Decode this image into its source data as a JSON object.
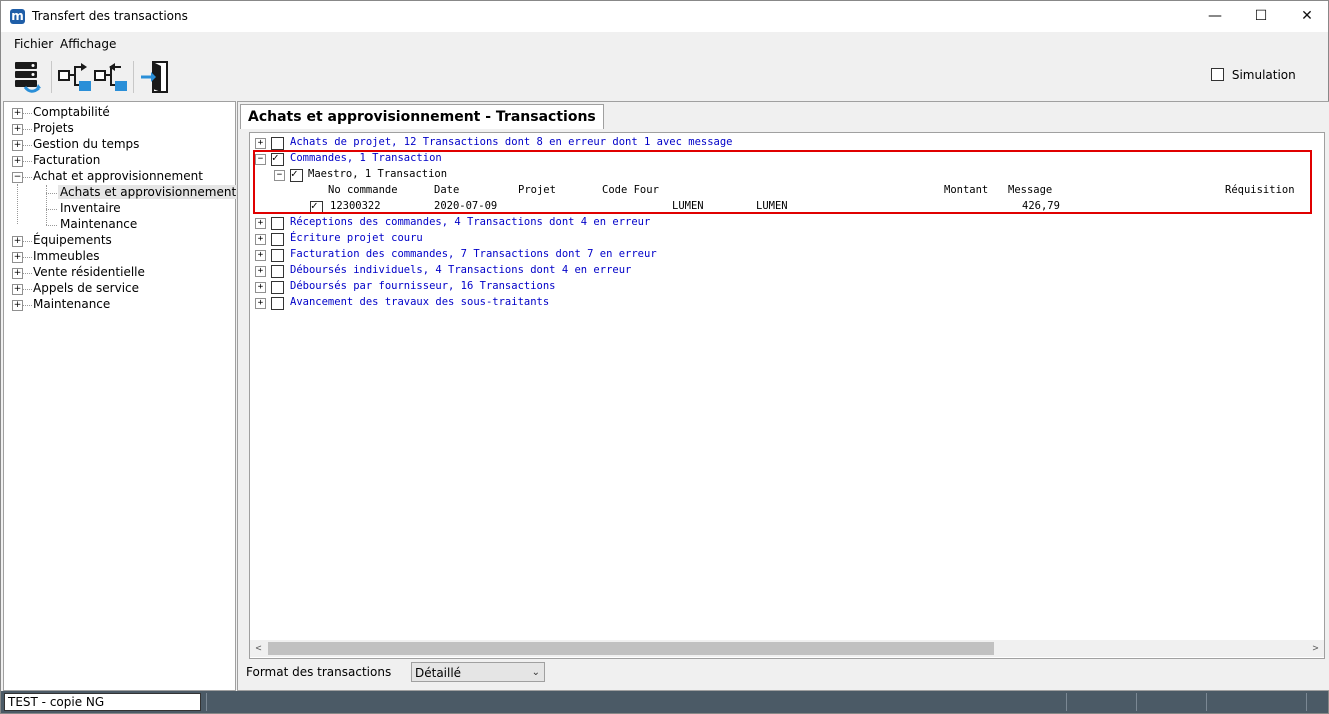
{
  "window": {
    "title": "Transfert des transactions",
    "app_icon_letter": "m",
    "controls": {
      "minimize": "—",
      "maximize": "☐",
      "close": "✕"
    }
  },
  "menu": [
    "Fichier",
    "Affichage"
  ],
  "toolbar": {
    "buttons": [
      "transfer-db-icon",
      "export-icon",
      "import-icon",
      "exit-icon"
    ],
    "simulation_label": "Simulation",
    "simulation_checked": false
  },
  "tree": {
    "items": [
      {
        "label": "Comptabilité",
        "expander": "+"
      },
      {
        "label": "Projets",
        "expander": "+"
      },
      {
        "label": "Gestion du temps",
        "expander": "+"
      },
      {
        "label": "Facturation",
        "expander": "+"
      },
      {
        "label": "Achat et approvisionnement",
        "expander": "−"
      },
      {
        "label": "Achats et approvisionnement",
        "child": true,
        "selected": true
      },
      {
        "label": "Inventaire",
        "child": true
      },
      {
        "label": "Maintenance",
        "child": true
      },
      {
        "label": "Équipements",
        "expander": "+"
      },
      {
        "label": "Immeubles",
        "expander": "+"
      },
      {
        "label": "Vente résidentielle",
        "expander": "+"
      },
      {
        "label": "Appels de service",
        "expander": "+"
      },
      {
        "label": "Maintenance",
        "expander": "+"
      }
    ]
  },
  "panel": {
    "tab_title": "Achats et approvisionnement - Transactions",
    "rows": [
      {
        "expander": "+",
        "checked": false,
        "text": "Achats de projet,   12 Transactions dont 8 en erreur dont 1 avec message"
      },
      {
        "expander": "−",
        "checked": true,
        "text": "Commandes,   1 Transaction"
      },
      {
        "expander": "−",
        "checked": true,
        "text": "Maestro,  1 Transaction"
      },
      {
        "expander": "+",
        "checked": false,
        "text": "Réceptions des commandes,   4 Transactions dont 4 en erreur"
      },
      {
        "expander": "+",
        "checked": false,
        "text": "Écriture projet couru"
      },
      {
        "expander": "+",
        "checked": false,
        "text": "Facturation des commandes,   7 Transactions dont 7 en erreur"
      },
      {
        "expander": "+",
        "checked": false,
        "text": "Déboursés individuels,   4 Transactions dont 4 en erreur"
      },
      {
        "expander": "+",
        "checked": false,
        "text": "Déboursés par fournisseur,   16 Transactions"
      },
      {
        "expander": "+",
        "checked": false,
        "text": "Avancement des travaux des sous-traitants"
      }
    ],
    "detail_headers": {
      "no_commande": "No commande",
      "date": "Date",
      "projet": "Projet",
      "code_four": "Code Four",
      "montant": "Montant",
      "message": "Message",
      "requisition": "Réquisition"
    },
    "detail_row": {
      "checked": true,
      "no_commande": "12300322",
      "date": "2020-07-09",
      "code_four": "LUMEN",
      "fournisseur": "LUMEN",
      "montant": "426,79"
    },
    "scroll": {
      "left": "<",
      "right": ">"
    },
    "format_label": "Format des transactions",
    "format_value": "Détaillé",
    "format_chevron": "⌄"
  },
  "status": {
    "database": "TEST - copie NG"
  },
  "colors": {
    "transaction_text": "#0000c8",
    "highlight_border": "#e00000",
    "statusbar": "#4b5a66"
  }
}
